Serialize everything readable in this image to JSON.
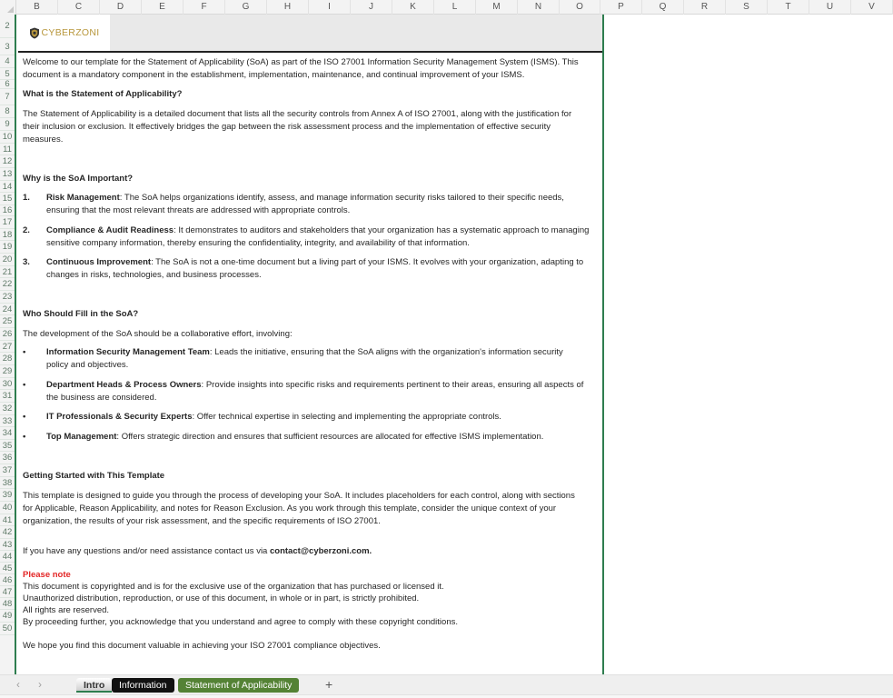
{
  "columns": [
    "B",
    "C",
    "D",
    "E",
    "F",
    "G",
    "H",
    "I",
    "J",
    "K",
    "L",
    "M",
    "N",
    "O",
    "P",
    "Q",
    "R",
    "S",
    "T",
    "U",
    "V"
  ],
  "rows": [
    "2",
    "3",
    "4",
    "5",
    "6",
    "7",
    "8",
    "9",
    "10",
    "11",
    "12",
    "13",
    "14",
    "15",
    "16",
    "17",
    "18",
    "19",
    "20",
    "21",
    "22",
    "23",
    "24",
    "25",
    "26",
    "27",
    "28",
    "29",
    "30",
    "31",
    "32",
    "33",
    "34",
    "35",
    "36",
    "37",
    "38",
    "39",
    "40",
    "41",
    "42",
    "43",
    "44",
    "45",
    "46",
    "47",
    "48",
    "49",
    "50"
  ],
  "logo": {
    "text": "CYBERZONI",
    "icon": "shield-icon",
    "color": "#b8973c"
  },
  "intro": {
    "line1": "Welcome to our template for the Statement of Applicability (SoA) as part of the ISO 27001 Information Security Management System (ISMS). This",
    "line2": "document is a mandatory component in the establishment, implementation, maintenance, and continual improvement of your ISMS."
  },
  "what": {
    "heading": "What is the Statement of Applicability?",
    "line1": "The Statement of Applicability is a detailed document that lists all the security controls from Annex A of ISO 27001, along with the justification for",
    "line2": "their inclusion or exclusion. It effectively bridges the gap between the risk assessment process and the implementation of effective security",
    "line3": "measures."
  },
  "why": {
    "heading": "Why is the SoA Important?",
    "items": [
      {
        "marker": "1.",
        "lead": "Risk Management",
        "line1": ": The SoA helps organizations identify, assess, and manage information security risks tailored to their specific needs,",
        "line2": "ensuring that the most relevant threats are addressed with appropriate controls."
      },
      {
        "marker": "2.",
        "lead": "Compliance & Audit Readiness",
        "line1": ": It demonstrates to auditors and stakeholders that your organization has a systematic approach to managing",
        "line2": "sensitive company information, thereby ensuring the confidentiality, integrity, and availability of that information."
      },
      {
        "marker": "3.",
        "lead": "Continuous Improvement",
        "line1": ": The SoA is not a one-time document but a living part of your ISMS. It evolves with your organization, adapting to",
        "line2": "changes in risks, technologies, and business processes."
      }
    ]
  },
  "who": {
    "heading": "Who Should Fill in the SoA?",
    "intro": "The development of the SoA should be a collaborative effort, involving:",
    "items": [
      {
        "marker": "•",
        "lead": "Information Security Management Team",
        "line1": ": Leads the initiative, ensuring that the SoA aligns with the organization's information security",
        "line2": "policy and objectives."
      },
      {
        "marker": "•",
        "lead": "Department Heads & Process Owners",
        "line1": ": Provide insights into specific risks and requirements pertinent to their areas, ensuring all aspects of",
        "line2": "the business are considered."
      },
      {
        "marker": "•",
        "lead": "IT Professionals & Security Experts",
        "line1": ": Offer technical expertise in selecting and implementing the appropriate controls.",
        "line2": ""
      },
      {
        "marker": "•",
        "lead": "Top Management",
        "line1": ": Offers strategic direction and ensures that sufficient resources are allocated for effective ISMS implementation.",
        "line2": ""
      }
    ]
  },
  "started": {
    "heading": "Getting Started with This Template",
    "line1": "This template is designed to guide you through the process of developing your SoA. It includes placeholders for each control, along with sections",
    "line2": "for Applicable, Reason Applicability, and notes for Reason Exclusion. As you work through this template, consider the unique context of your",
    "line3": "organization, the results of your risk assessment, and the specific requirements of ISO 27001."
  },
  "contact": {
    "text": "If you have any questions and/or need assistance contact us via ",
    "email": "contact@cyberzoni.com."
  },
  "note": {
    "heading": "Please note",
    "heading_color": "#e32626",
    "lines": [
      "This document is copyrighted and is for the exclusive use of the organization that has purchased or licensed it.",
      "Unauthorized distribution, reproduction, or use of this document, in whole or in part, is strictly prohibited.",
      "All rights are reserved.",
      "By proceeding further, you acknowledge that you understand and agree to comply with these copyright conditions."
    ]
  },
  "closing": "We hope you find this document valuable in achieving your ISO 27001 compliance objectives.",
  "tabs": {
    "prev": "‹",
    "next": "›",
    "items": [
      {
        "label": "Intro",
        "active": true
      },
      {
        "label": "Information",
        "color": "#111111"
      },
      {
        "label": "Statement of Applicability",
        "color": "#548235"
      }
    ],
    "add": "+"
  }
}
